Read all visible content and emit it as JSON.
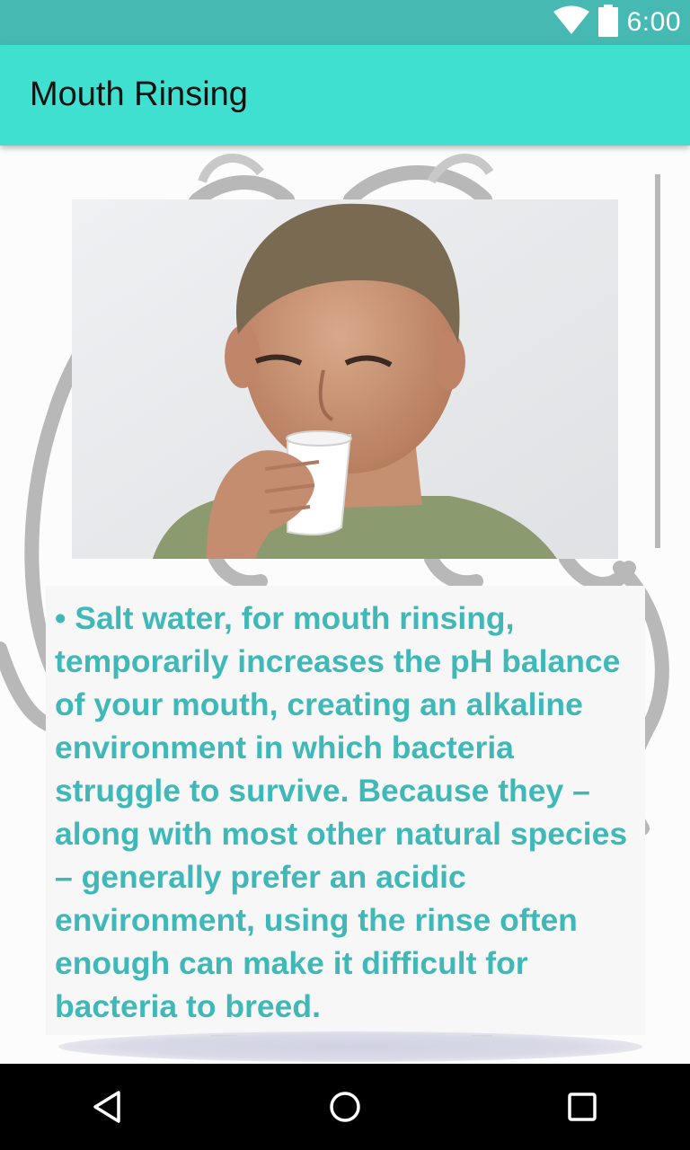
{
  "status_bar": {
    "time": "6:00",
    "icons": [
      "wifi-icon",
      "battery-icon"
    ]
  },
  "app_bar": {
    "title": "Mouth Rinsing",
    "color": "#40e0d0"
  },
  "content": {
    "image_alt": "Boy drinking from a small white cup",
    "text": "• Salt water, for mouth rinsing, temporarily increases the pH balance of your mouth, creating an alkaline environment in which bacteria struggle to survive. Because they – along with most other natural species – generally prefer an acidic environment, using the rinse often enough can make it difficult for bacteria to breed.",
    "text_color": "#40b8b8"
  },
  "nav_bar": {
    "buttons": [
      "back-icon",
      "home-icon",
      "recents-icon"
    ]
  }
}
